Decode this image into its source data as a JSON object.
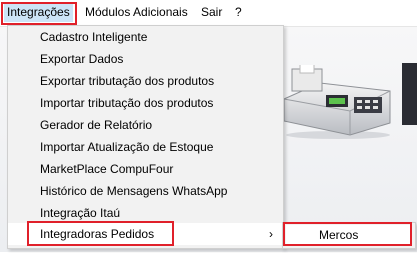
{
  "menubar": {
    "items": [
      {
        "label": "Integrações"
      },
      {
        "label": "Módulos Adicionais"
      },
      {
        "label": "Sair"
      },
      {
        "label": "?"
      }
    ]
  },
  "dropdown": {
    "items": [
      {
        "label": "Cadastro Inteligente"
      },
      {
        "label": "Exportar Dados"
      },
      {
        "label": "Exportar tributação dos produtos"
      },
      {
        "label": "Importar tributação dos produtos"
      },
      {
        "label": "Gerador de Relatório"
      },
      {
        "label": "Importar Atualização de Estoque"
      },
      {
        "label": "MarketPlace CompuFour"
      },
      {
        "label": "Histórico de Mensagens WhatsApp"
      },
      {
        "label": "Integração Itaú"
      },
      {
        "label": "Integradoras Pedidos",
        "has_submenu": true,
        "chevron": "›"
      }
    ]
  },
  "submenu": {
    "items": [
      {
        "label": "Mercos"
      }
    ]
  },
  "colors": {
    "highlight_border": "#e0202a",
    "menu_active": "#cce4f7",
    "menu_bg": "#f2f2f2"
  }
}
